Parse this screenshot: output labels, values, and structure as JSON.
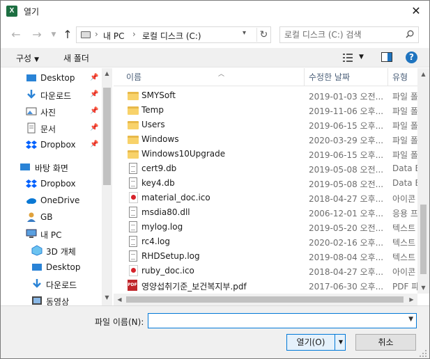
{
  "window": {
    "title": "열기",
    "app_icon": "X"
  },
  "nav": {
    "address": [
      "내 PC",
      "로컬 디스크 (C:)"
    ],
    "search_placeholder": "로컬 디스크 (C:) 검색"
  },
  "toolbar": {
    "organize_label": "구성",
    "new_folder_label": "새 폴더",
    "help_label": "?"
  },
  "sidebar": {
    "items": [
      {
        "label": "Desktop",
        "icon": "desktop-icon",
        "pinned": true
      },
      {
        "label": "다운로드",
        "icon": "download-icon",
        "pinned": true
      },
      {
        "label": "사진",
        "icon": "pictures-icon",
        "pinned": true
      },
      {
        "label": "문서",
        "icon": "documents-icon",
        "pinned": true
      },
      {
        "label": "Dropbox",
        "icon": "dropbox-icon",
        "pinned": true
      },
      {
        "label": "바탕 화면",
        "icon": "desktop-icon",
        "pinned": false
      },
      {
        "label": "Dropbox",
        "icon": "dropbox-icon",
        "pinned": false
      },
      {
        "label": "OneDrive",
        "icon": "onedrive-icon",
        "pinned": false
      },
      {
        "label": "GB",
        "icon": "user-icon",
        "pinned": false
      },
      {
        "label": "내 PC",
        "icon": "pc-icon",
        "pinned": false
      },
      {
        "label": "3D 개체",
        "icon": "3d-objects-icon",
        "pinned": false
      },
      {
        "label": "Desktop",
        "icon": "desktop-icon",
        "pinned": false
      },
      {
        "label": "다운로드",
        "icon": "download-icon",
        "pinned": false
      },
      {
        "label": "동영상",
        "icon": "videos-icon",
        "pinned": false
      }
    ]
  },
  "filelist": {
    "columns": {
      "name": "이름",
      "date": "수정한 날짜",
      "type": "유형"
    },
    "files": [
      {
        "name": "SMYSoft",
        "date": "2019-01-03 오전...",
        "type": "파일 폴",
        "kind": "folder"
      },
      {
        "name": "Temp",
        "date": "2019-11-06 오후...",
        "type": "파일 폴",
        "kind": "folder"
      },
      {
        "name": "Users",
        "date": "2019-06-15 오후...",
        "type": "파일 폴",
        "kind": "folder"
      },
      {
        "name": "Windows",
        "date": "2020-03-29 오후...",
        "type": "파일 폴",
        "kind": "folder"
      },
      {
        "name": "Windows10Upgrade",
        "date": "2019-06-15 오후...",
        "type": "파일 폴",
        "kind": "folder"
      },
      {
        "name": "cert9.db",
        "date": "2019-05-08 오전...",
        "type": "Data B",
        "kind": "doc"
      },
      {
        "name": "key4.db",
        "date": "2019-05-08 오전...",
        "type": "Data B",
        "kind": "doc"
      },
      {
        "name": "material_doc.ico",
        "date": "2018-04-27 오후...",
        "type": "아이콘",
        "kind": "ico"
      },
      {
        "name": "msdia80.dll",
        "date": "2006-12-01 오후...",
        "type": "응용 프",
        "kind": "doc"
      },
      {
        "name": "mylog.log",
        "date": "2019-05-20 오전...",
        "type": "텍스트",
        "kind": "doc"
      },
      {
        "name": "rc4.log",
        "date": "2020-02-16 오후...",
        "type": "텍스트",
        "kind": "doc"
      },
      {
        "name": "RHDSetup.log",
        "date": "2019-08-04 오후...",
        "type": "텍스트",
        "kind": "doc"
      },
      {
        "name": "ruby_doc.ico",
        "date": "2018-04-27 오후...",
        "type": "아이콘",
        "kind": "ico"
      },
      {
        "name": "영양섭취기준_보건복지부.pdf",
        "date": "2017-06-30 오후...",
        "type": "PDF 파",
        "kind": "pdf"
      }
    ]
  },
  "footer": {
    "filename_label": "파일 이름(N):",
    "filename_value": "",
    "open_label": "열기(O)",
    "cancel_label": "취소"
  },
  "colors": {
    "accent": "#0078d7",
    "folder": "#f8d26a",
    "excel": "#1d6f42",
    "help": "#1f74bf"
  }
}
